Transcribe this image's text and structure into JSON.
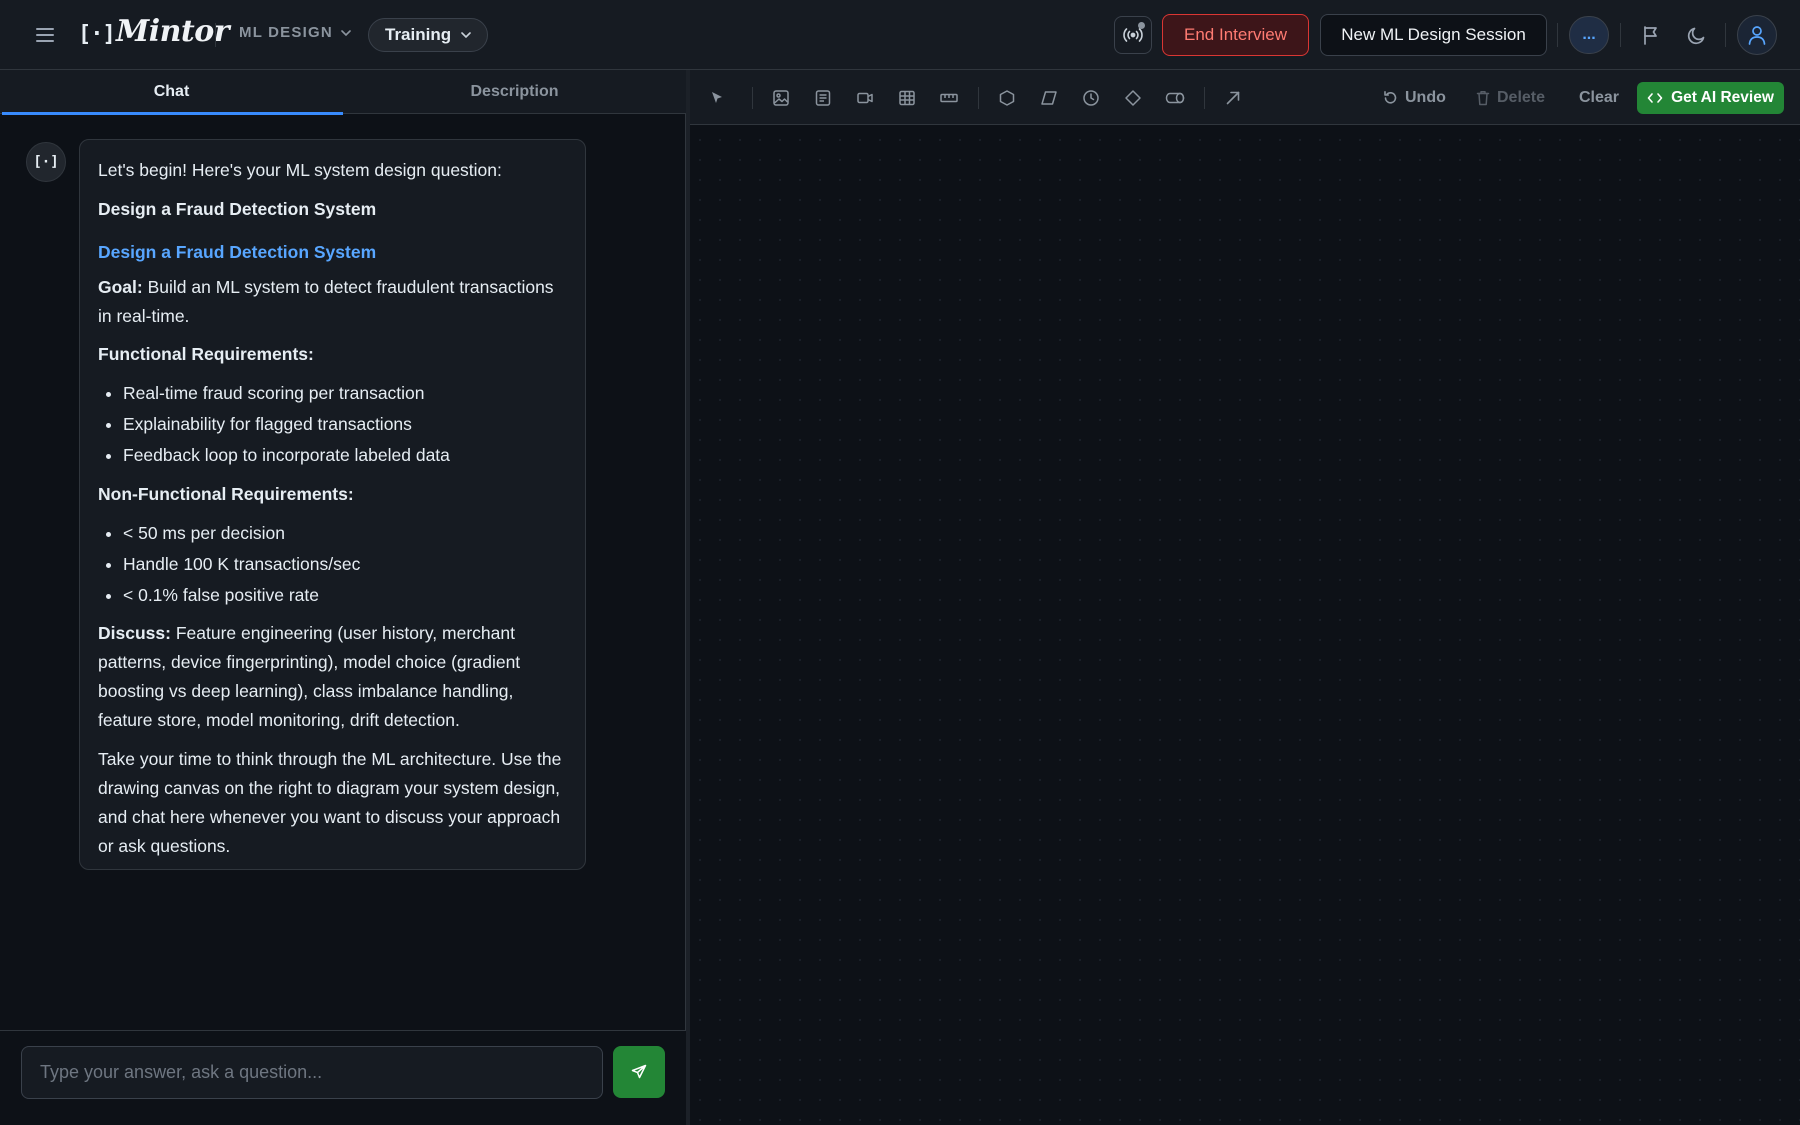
{
  "header": {
    "logo_mark": "[·]",
    "brand": "Mintor",
    "mode_label": "ML DESIGN",
    "training_label": "Training",
    "end_interview_label": "End Interview",
    "new_session_label": "New ML Design Session",
    "more_label": "...",
    "icons": [
      "menu-icon",
      "broadcast-icon",
      "flag-icon",
      "moon-icon",
      "user-icon"
    ]
  },
  "tabs": {
    "chat": "Chat",
    "description": "Description",
    "active": "Chat"
  },
  "chat": {
    "avatar": "[·]",
    "intro": "Let's begin! Here's your ML system design question:",
    "title": "Design a Fraud Detection System",
    "link_title": "Design a Fraud Detection System",
    "goal_label": "Goal:",
    "goal_text": "Build an ML system to detect fraudulent transactions in real-time.",
    "functional_heading": "Functional Requirements:",
    "functional": [
      "Real-time fraud scoring per transaction",
      "Explainability for flagged transactions",
      "Feedback loop to incorporate labeled data"
    ],
    "nonfunctional_heading": "Non-Functional Requirements:",
    "nonfunctional": [
      "< 50 ms per decision",
      "Handle 100 K transactions/sec",
      "< 0.1% false positive rate"
    ],
    "discuss_label": "Discuss:",
    "discuss_text": "Feature engineering (user history, merchant patterns, device fingerprinting), model choice (gradient boosting vs deep learning), class imbalance handling, feature store, model monitoring, drift detection.",
    "closing": "Take your time to think through the ML architecture. Use the drawing canvas on the right to diagram your system design, and chat here whenever you want to discuss your approach or ask questions.",
    "input_placeholder": "Type your answer, ask a question...",
    "input_value": ""
  },
  "toolbar": {
    "tools": [
      "select-icon",
      "image-icon",
      "text-icon",
      "video-icon",
      "table-icon",
      "ruler-icon",
      "hexagon-icon",
      "parallelogram-icon",
      "clock-icon",
      "diamond-icon",
      "cylinder-icon",
      "arrow-icon"
    ],
    "undo_label": "Undo",
    "delete_label": "Delete",
    "clear_label": "Clear",
    "review_label": "Get AI Review"
  },
  "colors": {
    "background": "#0d1117",
    "panel": "#161b22",
    "accent_blue": "#58a6ff",
    "tab_underline": "#388bfd",
    "end_interview_red": "#ff7b72",
    "primary_green": "#238636"
  }
}
